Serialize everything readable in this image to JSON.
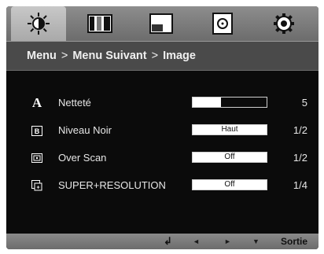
{
  "tabs": [
    {
      "id": "picture",
      "icon": "brightness-sun-icon",
      "active": true
    },
    {
      "id": "color",
      "icon": "color-bars-icon",
      "active": false
    },
    {
      "id": "display",
      "icon": "screen-position-icon",
      "active": false
    },
    {
      "id": "input",
      "icon": "disc-icon",
      "active": false
    },
    {
      "id": "setup",
      "icon": "gear-icon",
      "active": false
    }
  ],
  "breadcrumb": {
    "root": "Menu",
    "sep1": ">",
    "middle": "Menu Suivant",
    "sep2": ">",
    "current": "Image"
  },
  "rows": [
    {
      "label": "Netteté",
      "icon": "sharpness-a-icon",
      "type": "slider",
      "level": 0.38,
      "count": "5"
    },
    {
      "label": "Niveau Noir",
      "icon": "black-level-icon",
      "type": "select",
      "value": "Haut",
      "count": "1/2"
    },
    {
      "label": "Over Scan",
      "icon": "overscan-icon",
      "type": "select",
      "value": "Off",
      "count": "1/2"
    },
    {
      "label": "SUPER+RESOLUTION",
      "icon": "super-resolution-icon",
      "type": "select",
      "value": "Off",
      "count": "1/4"
    }
  ],
  "footer": {
    "enter": "↲",
    "left": "◄",
    "right": "►",
    "down": "▼",
    "exit": "Sortie"
  },
  "colors": {
    "osd_bg": "#0b0b0b",
    "header_bg": "#4a4a4a",
    "tab_bg": "#7a7a7a",
    "tab_active": "#bdbdbd"
  }
}
